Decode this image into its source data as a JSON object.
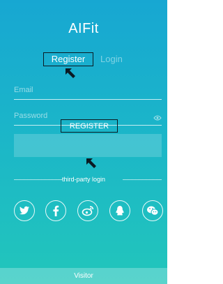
{
  "app": {
    "title": "AIFit"
  },
  "tabs": {
    "register": "Register",
    "login": "Login"
  },
  "form": {
    "email": {
      "placeholder": "Email",
      "value": ""
    },
    "password": {
      "placeholder": "Password",
      "value": ""
    },
    "submit_label": "REGISTER"
  },
  "divider": {
    "label": "third-party login"
  },
  "socials": [
    {
      "name": "twitter-icon"
    },
    {
      "name": "facebook-icon"
    },
    {
      "name": "weibo-icon"
    },
    {
      "name": "qq-icon"
    },
    {
      "name": "wechat-icon"
    }
  ],
  "footer": {
    "visitor_label": "Visitor"
  },
  "colors": {
    "gradient_top": "#17a7d2",
    "gradient_bottom": "#22c6bb",
    "annotation_box": "#0b1a22"
  }
}
